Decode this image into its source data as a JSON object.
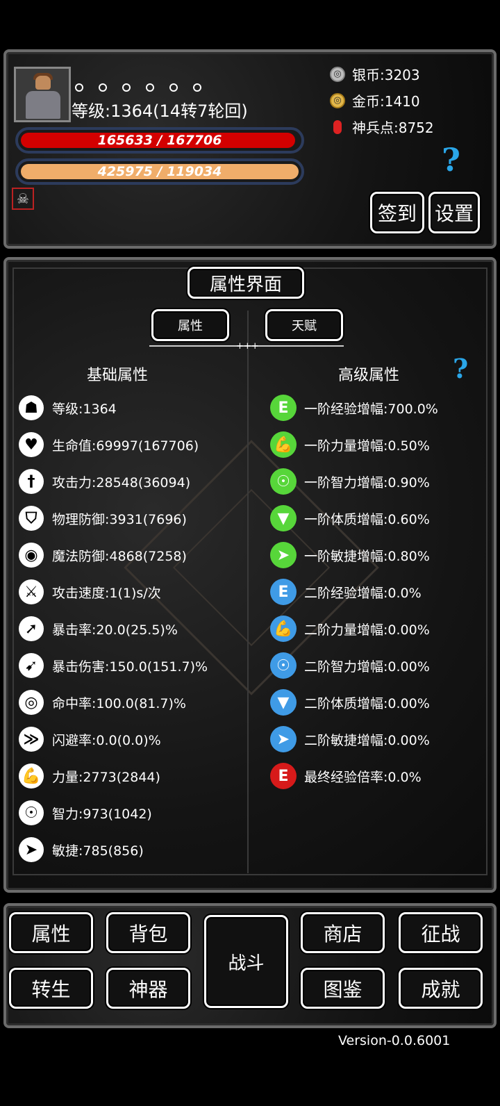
{
  "header": {
    "level_text": "等级:1364(14转7轮回)",
    "hp_text": "165633 / 167706",
    "hp_fraction": 0.988,
    "mp_text": "425975 / 119034",
    "mp_fraction": 1.0,
    "currencies": {
      "silver": "银币:3203",
      "gold": "金币:1410",
      "shenbing": "神兵点:8752"
    },
    "help_glyph": "?",
    "sign_in": "签到",
    "settings": "设置"
  },
  "attr_panel": {
    "title": "属性界面",
    "tabs": [
      "属性",
      "天赋"
    ],
    "basic_heading": "基础属性",
    "advanced_heading": "高级属性",
    "basic_stats": [
      {
        "label": "等级:1364",
        "icon": "level-icon"
      },
      {
        "label": "生命值:69997(167706)",
        "icon": "heart-icon"
      },
      {
        "label": "攻击力:28548(36094)",
        "icon": "sword-icon"
      },
      {
        "label": "物理防御:3931(7696)",
        "icon": "shield-icon"
      },
      {
        "label": "魔法防御:4868(7258)",
        "icon": "magic-shield-icon"
      },
      {
        "label": "攻击速度:1(1)s/次",
        "icon": "attack-speed-icon"
      },
      {
        "label": "暴击率:20.0(25.5)%",
        "icon": "crit-rate-icon"
      },
      {
        "label": "暴击伤害:150.0(151.7)%",
        "icon": "crit-damage-icon"
      },
      {
        "label": "命中率:100.0(81.7)%",
        "icon": "target-icon"
      },
      {
        "label": "闪避率:0.0(0.0)%",
        "icon": "dodge-icon"
      },
      {
        "label": "力量:2773(2844)",
        "icon": "strength-icon"
      },
      {
        "label": "智力:973(1042)",
        "icon": "intelligence-icon"
      },
      {
        "label": "敏捷:785(856)",
        "icon": "agility-icon"
      }
    ],
    "advanced_stats": [
      {
        "label": "一阶经验增幅:700.0%",
        "icon": "exp-icon",
        "color": "#57d63a"
      },
      {
        "label": "一阶力量增幅:0.50%",
        "icon": "strength-icon",
        "color": "#57d63a"
      },
      {
        "label": "一阶智力增幅:0.90%",
        "icon": "intelligence-icon",
        "color": "#57d63a"
      },
      {
        "label": "一阶体质增幅:0.60%",
        "icon": "constitution-icon",
        "color": "#57d63a"
      },
      {
        "label": "一阶敏捷增幅:0.80%",
        "icon": "agility-icon",
        "color": "#57d63a"
      },
      {
        "label": "二阶经验增幅:0.0%",
        "icon": "exp-icon",
        "color": "#3f9be6"
      },
      {
        "label": "二阶力量增幅:0.00%",
        "icon": "strength-icon",
        "color": "#3f9be6"
      },
      {
        "label": "二阶智力增幅:0.00%",
        "icon": "intelligence-icon",
        "color": "#3f9be6"
      },
      {
        "label": "二阶体质增幅:0.00%",
        "icon": "constitution-icon",
        "color": "#3f9be6"
      },
      {
        "label": "二阶敏捷增幅:0.00%",
        "icon": "agility-icon",
        "color": "#3f9be6"
      },
      {
        "label": "最终经验倍率:0.0%",
        "icon": "exp-icon",
        "color": "#d71a1a"
      }
    ]
  },
  "nav": {
    "attr": "属性",
    "bag": "背包",
    "fight": "战斗",
    "shop": "商店",
    "war": "征战",
    "reborn": "转生",
    "artifact": "神器",
    "atlas": "图鉴",
    "achieve": "成就"
  },
  "version": "Version-0.0.6001"
}
